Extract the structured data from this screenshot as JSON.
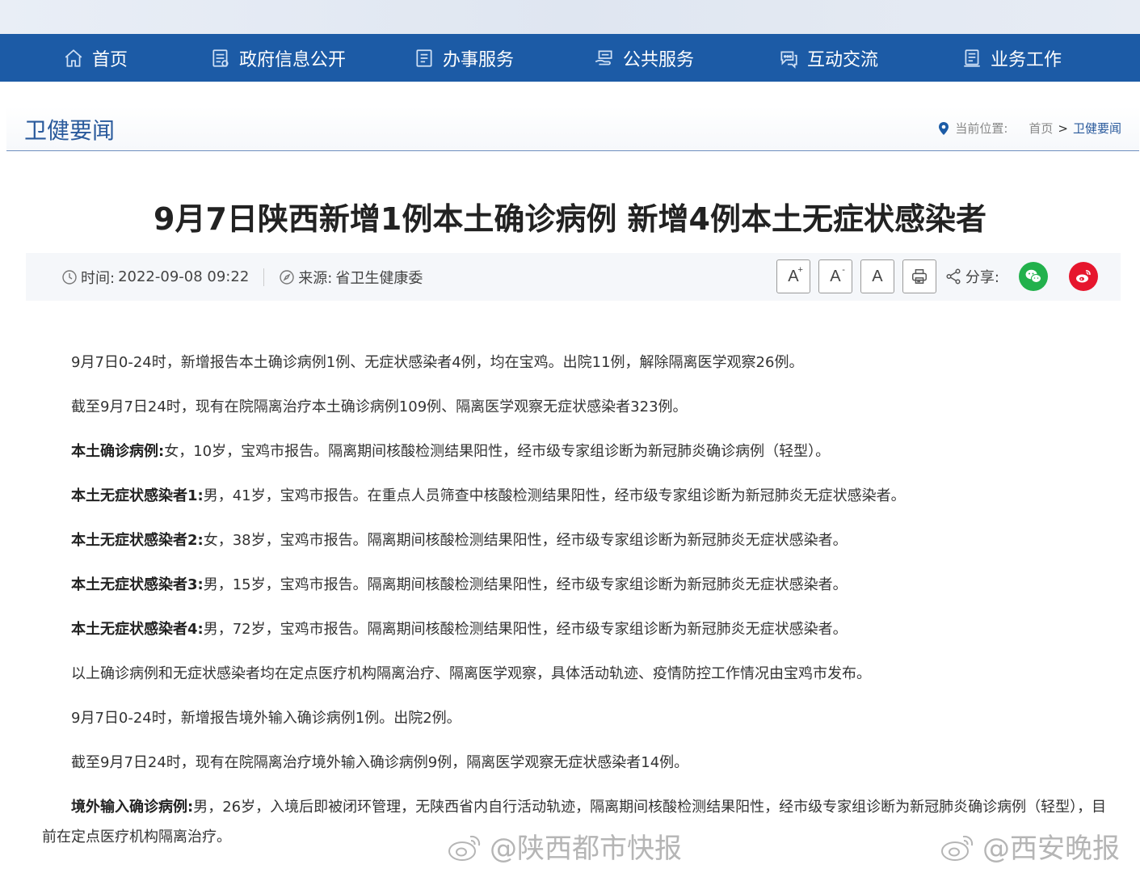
{
  "nav": {
    "items": [
      {
        "label": "首页",
        "icon": "home-icon"
      },
      {
        "label": "政府信息公开",
        "icon": "document-list-icon"
      },
      {
        "label": "办事服务",
        "icon": "form-icon"
      },
      {
        "label": "公共服务",
        "icon": "hand-service-icon"
      },
      {
        "label": "互动交流",
        "icon": "chat-bubbles-icon"
      },
      {
        "label": "业务工作",
        "icon": "book-icon"
      }
    ]
  },
  "section": {
    "title": "卫健要闻"
  },
  "breadcrumb": {
    "prefix": "当前位置:",
    "home": "首页",
    "separator": ">",
    "current": "卫健要闻"
  },
  "article": {
    "title": "9月7日陕西新增1例本土确诊病例 新增4例本土无症状感染者",
    "time_label": "时间:",
    "time_value": "2022-09-08 09:22",
    "source_label": "来源:",
    "source_value": "省卫生健康委"
  },
  "tools": {
    "font_large": "A",
    "font_large_mark": "+",
    "font_small": "A",
    "font_small_mark": "-",
    "font_reset": "A",
    "share_label": "分享:"
  },
  "paragraphs": [
    {
      "lead": "",
      "text": "9月7日0-24时，新增报告本土确诊病例1例、无症状感染者4例，均在宝鸡。出院11例，解除隔离医学观察26例。"
    },
    {
      "lead": "",
      "text": "截至9月7日24时，现有在院隔离治疗本土确诊病例109例、隔离医学观察无症状感染者323例。"
    },
    {
      "lead": "本土确诊病例:",
      "text": "女，10岁，宝鸡市报告。隔离期间核酸检测结果阳性，经市级专家组诊断为新冠肺炎确诊病例（轻型）。"
    },
    {
      "lead": "本土无症状感染者1:",
      "text": "男，41岁，宝鸡市报告。在重点人员筛查中核酸检测结果阳性，经市级专家组诊断为新冠肺炎无症状感染者。"
    },
    {
      "lead": "本土无症状感染者2:",
      "text": "女，38岁，宝鸡市报告。隔离期间核酸检测结果阳性，经市级专家组诊断为新冠肺炎无症状感染者。"
    },
    {
      "lead": "本土无症状感染者3:",
      "text": "男，15岁，宝鸡市报告。隔离期间核酸检测结果阳性，经市级专家组诊断为新冠肺炎无症状感染者。"
    },
    {
      "lead": "本土无症状感染者4:",
      "text": "男，72岁，宝鸡市报告。隔离期间核酸检测结果阳性，经市级专家组诊断为新冠肺炎无症状感染者。"
    },
    {
      "lead": "",
      "text": "以上确诊病例和无症状感染者均在定点医疗机构隔离治疗、隔离医学观察，具体活动轨迹、疫情防控工作情况由宝鸡市发布。"
    },
    {
      "lead": "",
      "text": "9月7日0-24时，新增报告境外输入确诊病例1例。出院2例。"
    },
    {
      "lead": "",
      "text": "截至9月7日24时，现有在院隔离治疗境外输入确诊病例9例，隔离医学观察无症状感染者14例。"
    },
    {
      "lead": "境外输入确诊病例:",
      "text": "男，26岁，入境后即被闭环管理，无陕西省内自行活动轨迹，隔离期间核酸检测结果阳性，经市级专家组诊断为新冠肺炎确诊病例（轻型），目前在定点医疗机构隔离治疗。"
    }
  ],
  "watermarks": [
    {
      "text": "@陕西都市快报"
    },
    {
      "text": "@西安晚报"
    }
  ],
  "colors": {
    "nav_bg": "#1c5ba6",
    "accent": "#2a5a9c",
    "wechat": "#22b14c",
    "weibo": "#e6162d"
  }
}
